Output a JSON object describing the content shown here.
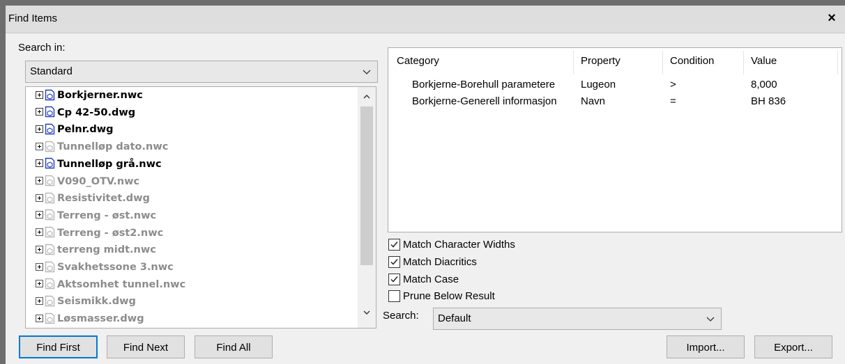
{
  "window": {
    "title": "Find Items",
    "close_glyph": "×"
  },
  "search_in": {
    "label": "Search in:",
    "selected": "Standard"
  },
  "tree": {
    "items": [
      {
        "name": "Borkjerner.nwc",
        "active": true
      },
      {
        "name": "Cp 42-50.dwg",
        "active": true
      },
      {
        "name": "Pelnr.dwg",
        "active": true
      },
      {
        "name": "Tunnelløp dato.nwc",
        "active": false
      },
      {
        "name": "Tunnelløp grå.nwc",
        "active": true
      },
      {
        "name": "V090_OTV.nwc",
        "active": false
      },
      {
        "name": "Resistivitet.dwg",
        "active": false
      },
      {
        "name": "Terreng - øst.nwc",
        "active": false
      },
      {
        "name": "Terreng - øst2.nwc",
        "active": false
      },
      {
        "name": "terreng midt.nwc",
        "active": false
      },
      {
        "name": "Svakhetssone 3.nwc",
        "active": false
      },
      {
        "name": "Aktsomhet tunnel.nwc",
        "active": false
      },
      {
        "name": "Seismikk.dwg",
        "active": false
      },
      {
        "name": "Løsmasser.dwg",
        "active": false
      }
    ]
  },
  "conditions": {
    "headers": {
      "category": "Category",
      "property": "Property",
      "condition": "Condition",
      "value": "Value"
    },
    "rows": [
      {
        "category": "Borkjerne-Borehull parametere",
        "property": "Lugeon",
        "condition": ">",
        "value": "8,000"
      },
      {
        "category": "Borkjerne-Generell informasjon",
        "property": "Navn",
        "condition": "=",
        "value": "BH 836"
      }
    ]
  },
  "options": {
    "match_character_widths": {
      "label": "Match Character Widths",
      "checked": true
    },
    "match_diacritics": {
      "label": "Match Diacritics",
      "checked": true
    },
    "match_case": {
      "label": "Match Case",
      "checked": true
    },
    "prune_below_result": {
      "label": "Prune Below Result",
      "checked": false
    }
  },
  "search": {
    "label": "Search:",
    "selected": "Default"
  },
  "buttons": {
    "find_first": "Find First",
    "find_next": "Find Next",
    "find_all": "Find All",
    "import": "Import...",
    "export": "Export..."
  },
  "colors": {
    "file_icon_active": "#1f3fbf",
    "file_icon_inactive": "#b8b8b8",
    "default_button_border": "#0078d7"
  }
}
